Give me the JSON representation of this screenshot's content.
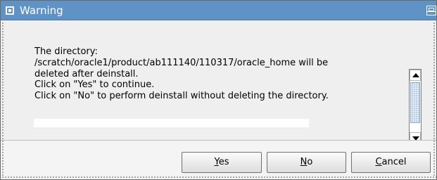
{
  "dialog": {
    "title": "Warning",
    "message_lines": [
      "The directory:",
      "/scratch/oracle1/product/ab111140/110317/oracle_home will be",
      "deleted after deinstall.",
      "Click on \"Yes\" to continue.",
      "Click on \"No\" to perform deinstall without deleting the directory."
    ],
    "buttons": {
      "yes": {
        "mnemonic": "Y",
        "rest": "es"
      },
      "no": {
        "mnemonic": "N",
        "rest": "o"
      },
      "cancel": {
        "mnemonic": "C",
        "rest": "ancel"
      }
    }
  },
  "icons": {
    "window": "window-icon",
    "restore": "restore-icon",
    "scroll_up": "scroll-up-icon",
    "scroll_down": "scroll-down-icon"
  },
  "colors": {
    "titlebar": "#5f93c6",
    "dialog_background": "#efefef",
    "button_border": "#6f6f6f",
    "scroll_thumb": "#b9cee6"
  }
}
